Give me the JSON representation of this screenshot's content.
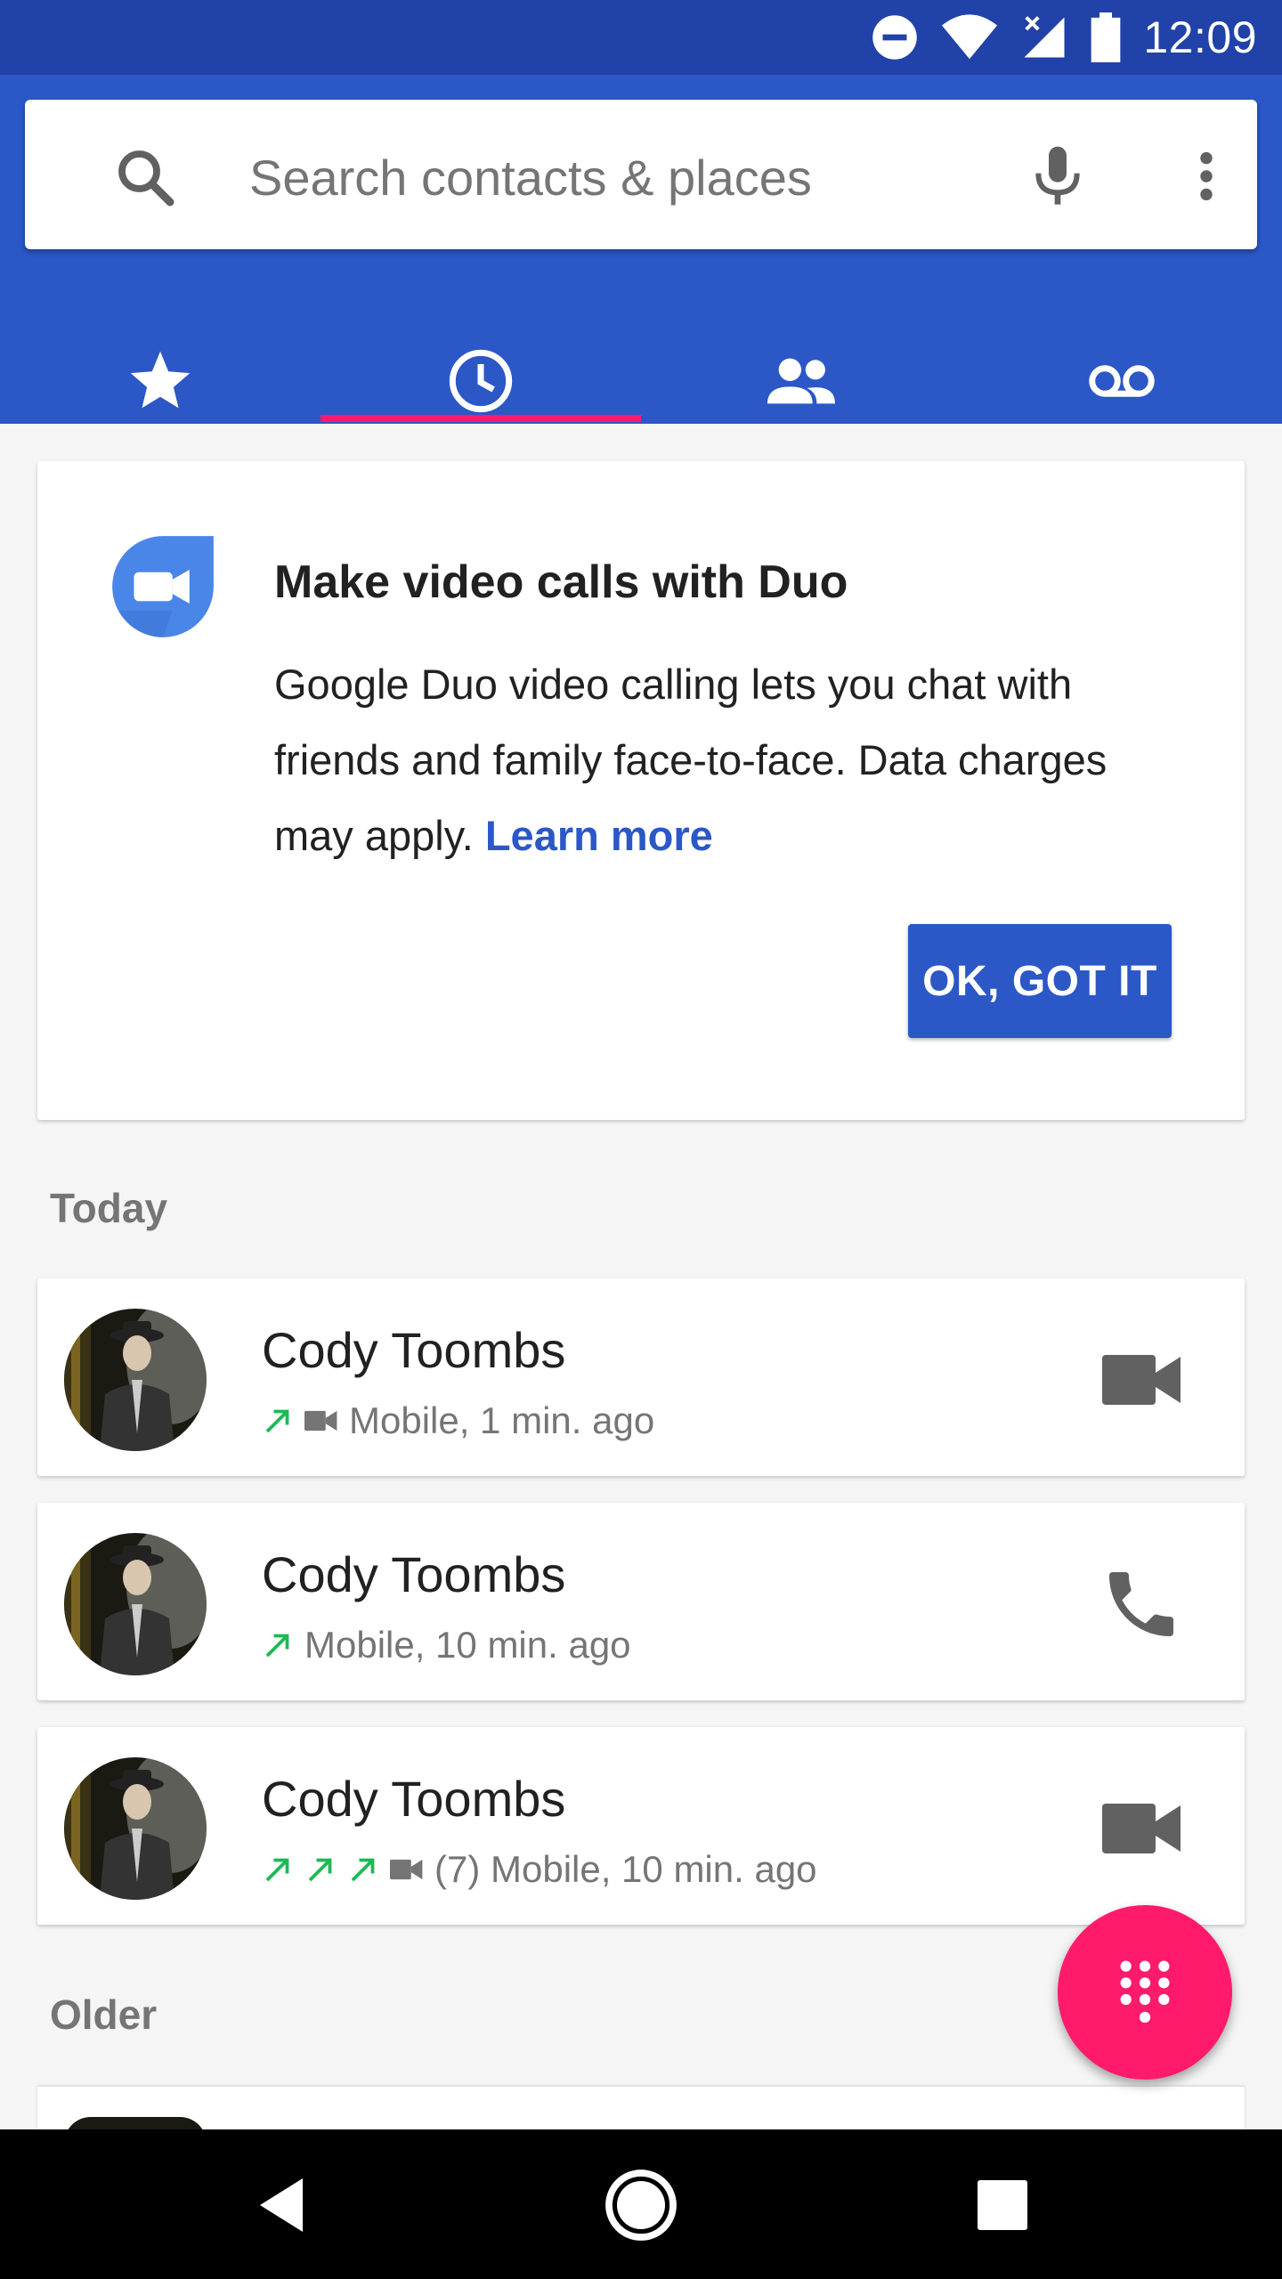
{
  "status_bar": {
    "time": "12:09"
  },
  "search": {
    "placeholder": "Search contacts & places"
  },
  "tabs": [
    {
      "icon": "star-icon",
      "label": "Speed dial"
    },
    {
      "icon": "clock-icon",
      "label": "Recents",
      "selected": true
    },
    {
      "icon": "contacts-icon",
      "label": "Contacts"
    },
    {
      "icon": "voicemail-icon",
      "label": "Voicemail"
    }
  ],
  "duo_card": {
    "title": "Make video calls with Duo",
    "body": "Google Duo video calling lets you chat with friends and family face-to-face. Data charges may apply.",
    "link": "Learn more",
    "button": "OK, GOT IT"
  },
  "sections": {
    "today": "Today",
    "older": "Older"
  },
  "calls": [
    {
      "name": "Cody Toombs",
      "meta": "Mobile, 1 min. ago",
      "arrows": 1,
      "video": true,
      "action": "video-call-icon"
    },
    {
      "name": "Cody Toombs",
      "meta": "Mobile, 10 min. ago",
      "arrows": 1,
      "video": false,
      "action": "phone-icon"
    },
    {
      "name": "Cody Toombs",
      "meta": "(7) Mobile, 10 min. ago",
      "arrows": 3,
      "video": true,
      "action": "video-call-icon"
    }
  ],
  "colors": {
    "status_bar": "#2142a8",
    "app_bar": "#2b57c7",
    "accent": "#ff1a6b",
    "outgoing_arrow": "#1db954"
  }
}
